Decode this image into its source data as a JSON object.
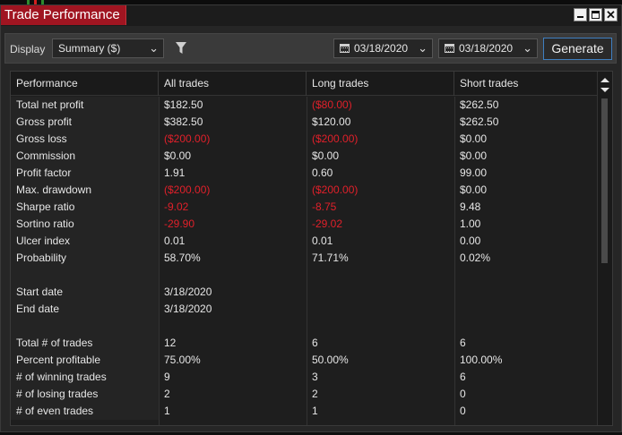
{
  "window": {
    "title": "Trade Performance"
  },
  "toolbar": {
    "display_label": "Display",
    "display_value": "Summary ($)",
    "date_from": "03/18/2020",
    "date_to": "03/18/2020",
    "generate_label": "Generate"
  },
  "table": {
    "headers": [
      "Performance",
      "All trades",
      "Long trades",
      "Short trades"
    ],
    "rows": [
      {
        "label": "Total net profit",
        "all": "$182.50",
        "long": "($80.00)",
        "short": "$262.50",
        "neg": [
          false,
          true,
          false
        ]
      },
      {
        "label": "Gross profit",
        "all": "$382.50",
        "long": "$120.00",
        "short": "$262.50",
        "neg": [
          false,
          false,
          false
        ]
      },
      {
        "label": "Gross loss",
        "all": "($200.00)",
        "long": "($200.00)",
        "short": "$0.00",
        "neg": [
          true,
          true,
          false
        ]
      },
      {
        "label": "Commission",
        "all": "$0.00",
        "long": "$0.00",
        "short": "$0.00",
        "neg": [
          false,
          false,
          false
        ]
      },
      {
        "label": "Profit factor",
        "all": "1.91",
        "long": "0.60",
        "short": "99.00",
        "neg": [
          false,
          false,
          false
        ]
      },
      {
        "label": "Max. drawdown",
        "all": "($200.00)",
        "long": "($200.00)",
        "short": "$0.00",
        "neg": [
          true,
          true,
          false
        ]
      },
      {
        "label": "Sharpe ratio",
        "all": "-9.02",
        "long": "-8.75",
        "short": "9.48",
        "neg": [
          true,
          true,
          false
        ]
      },
      {
        "label": "Sortino ratio",
        "all": "-29.90",
        "long": "-29.02",
        "short": "1.00",
        "neg": [
          true,
          true,
          false
        ]
      },
      {
        "label": "Ulcer index",
        "all": "0.01",
        "long": "0.01",
        "short": "0.00",
        "neg": [
          false,
          false,
          false
        ]
      },
      {
        "label": "Probability",
        "all": "58.70%",
        "long": "71.71%",
        "short": "0.02%",
        "neg": [
          false,
          false,
          false
        ]
      },
      {
        "label": "",
        "all": "",
        "long": "",
        "short": "",
        "neg": [
          false,
          false,
          false
        ]
      },
      {
        "label": "Start date",
        "all": "3/18/2020",
        "long": "",
        "short": "",
        "neg": [
          false,
          false,
          false
        ]
      },
      {
        "label": "End date",
        "all": "3/18/2020",
        "long": "",
        "short": "",
        "neg": [
          false,
          false,
          false
        ]
      },
      {
        "label": "",
        "all": "",
        "long": "",
        "short": "",
        "neg": [
          false,
          false,
          false
        ]
      },
      {
        "label": "Total # of trades",
        "all": "12",
        "long": "6",
        "short": "6",
        "neg": [
          false,
          false,
          false
        ]
      },
      {
        "label": "Percent profitable",
        "all": "75.00%",
        "long": "50.00%",
        "short": "100.00%",
        "neg": [
          false,
          false,
          false
        ]
      },
      {
        "label": "# of winning trades",
        "all": "9",
        "long": "3",
        "short": "6",
        "neg": [
          false,
          false,
          false
        ]
      },
      {
        "label": "# of losing trades",
        "all": "2",
        "long": "2",
        "short": "0",
        "neg": [
          false,
          false,
          false
        ]
      },
      {
        "label": "# of even trades",
        "all": "1",
        "long": "1",
        "short": "0",
        "neg": [
          false,
          false,
          false
        ]
      }
    ]
  },
  "colors": {
    "title_tab": "#a01521",
    "negative": "#e0202a",
    "generate_border": "#3f7fc0"
  }
}
